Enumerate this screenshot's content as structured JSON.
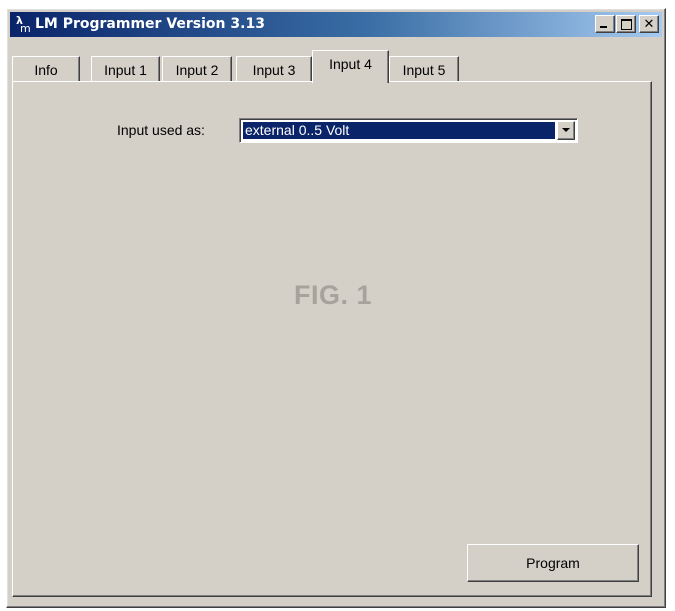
{
  "window": {
    "title": "LM Programmer Version 3.13",
    "icon_glyph_top": "λ",
    "icon_glyph_bottom": "m",
    "icon_name": "app-icon",
    "controls": {
      "minimize_icon": "minimize-icon",
      "maximize_icon": "maximize-icon",
      "close_icon": "close-icon",
      "close_glyph": "✕"
    }
  },
  "tabs": [
    {
      "label": "Info",
      "active": false
    },
    {
      "label": "Input 1",
      "active": false
    },
    {
      "label": "Input 2",
      "active": false
    },
    {
      "label": "Input 3",
      "active": false
    },
    {
      "label": "Input 4",
      "active": true
    },
    {
      "label": "Input 5",
      "active": false
    }
  ],
  "panel": {
    "input_used_as_label": "Input used as:",
    "input_used_as_value": "external 0..5 Volt",
    "figure_label": "FIG. 1",
    "program_button_label": "Program"
  },
  "colors": {
    "titlebar_start": "#0a246a",
    "titlebar_end": "#a6caf0",
    "face": "#d4d0c8",
    "selection": "#0a246a"
  }
}
